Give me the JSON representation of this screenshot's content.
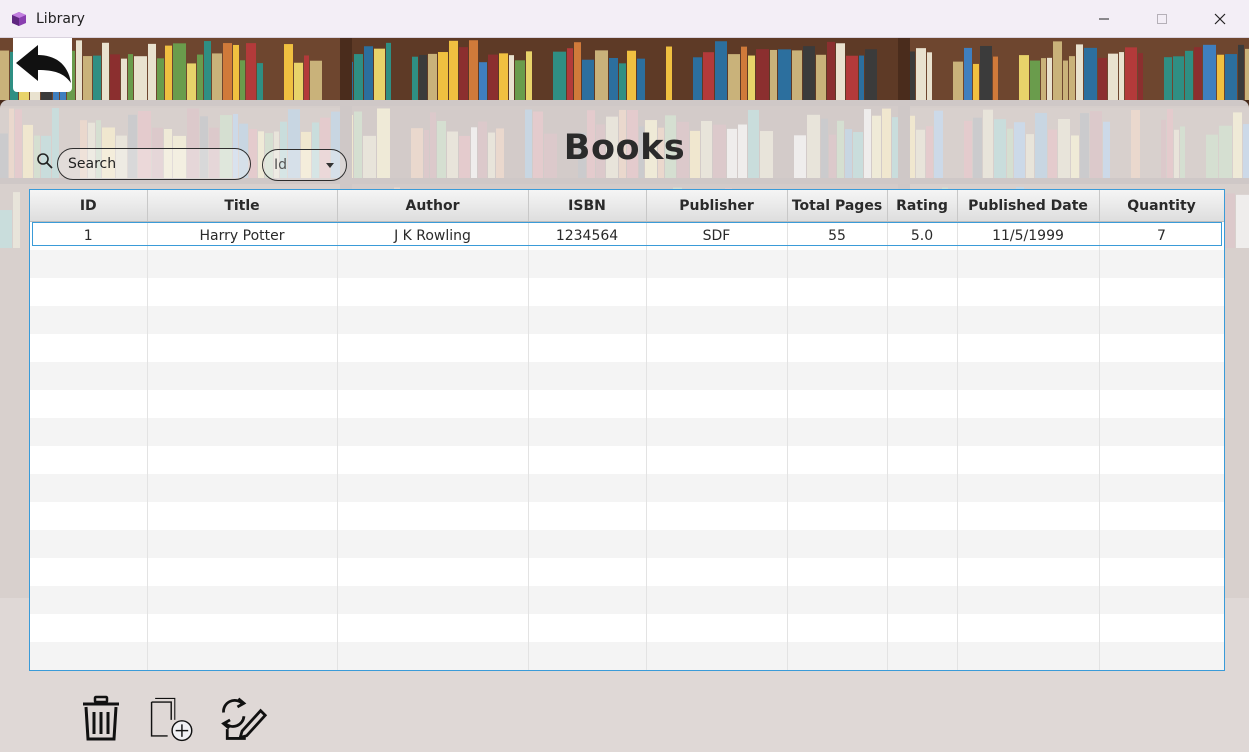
{
  "window": {
    "title": "Library",
    "icon": "library-app-icon",
    "controls": [
      "minimize-icon",
      "maximize-icon",
      "close-icon"
    ]
  },
  "page": {
    "title": "Books",
    "back_icon": "back-arrow-icon"
  },
  "search": {
    "placeholder": "Search",
    "value": "",
    "icon": "search-icon"
  },
  "filter": {
    "selected": "Id"
  },
  "table": {
    "columns": [
      "ID",
      "Title",
      "Author",
      "ISBN",
      "Publisher",
      "Total Pages",
      "Rating",
      "Published Date",
      "Quantity"
    ],
    "rows": [
      [
        "1",
        "Harry Potter",
        "J K Rowling",
        "1234564",
        "SDF",
        "55",
        "5.0",
        "11/5/1999",
        "7"
      ]
    ],
    "selected_row": 0
  },
  "toolbar": {
    "icons": [
      "trash-icon",
      "add-book-icon",
      "update-book-icon"
    ]
  },
  "colors": {
    "selection": "#3a9bd8",
    "title_text": "#2b2b2b"
  }
}
